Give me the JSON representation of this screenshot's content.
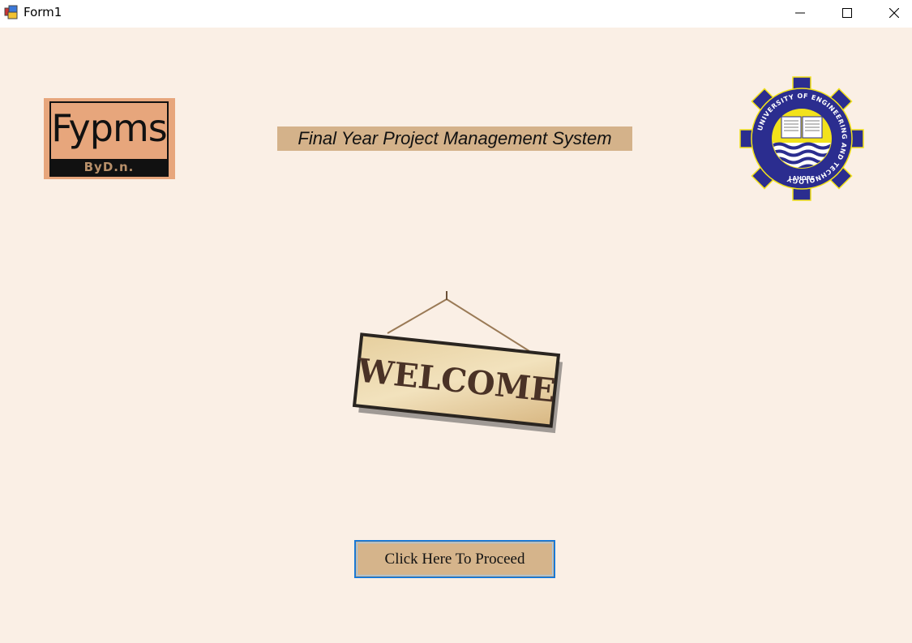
{
  "window": {
    "title": "Form1",
    "controls": [
      "minimize-icon",
      "maximize-icon",
      "close-icon"
    ]
  },
  "logo": {
    "word": "Fypms",
    "byline": "ByD.n."
  },
  "header": {
    "title": "Final Year Project Management System"
  },
  "university_logo": {
    "ring_text": "UNIVERSITY OF ENGINEERING AND TECHNOLOGY",
    "city": "LAHORE"
  },
  "welcome_sign": {
    "text": "WELCOME"
  },
  "proceed_button": {
    "label": "Click Here To Proceed"
  },
  "colors": {
    "background": "#faefe5",
    "title_band": "#d4b28a",
    "button": "#d5b48b",
    "button_border": "#1979d6",
    "logo_bg": "#e7a67c",
    "uet_blue": "#2b2d8f",
    "uet_yellow": "#f2e21b"
  }
}
